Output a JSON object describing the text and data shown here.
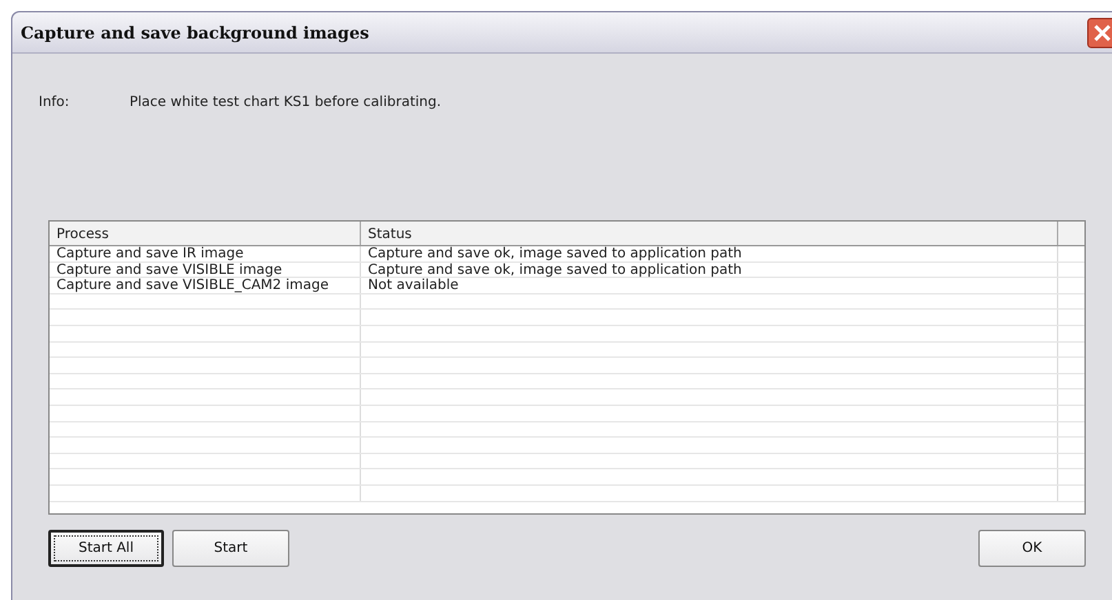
{
  "window": {
    "title": "Capture and save background images"
  },
  "info": {
    "label": "Info:",
    "text": "Place white test chart KS1 before calibrating."
  },
  "table": {
    "columns": [
      "Process",
      "Status"
    ],
    "rows": [
      {
        "process": "Capture and save IR image",
        "status": "Capture and save ok, image saved to application path"
      },
      {
        "process": "Capture and save VISIBLE image",
        "status": "Capture and save ok, image saved to application path"
      },
      {
        "process": "Capture and save VISIBLE_CAM2 image",
        "status": "Not available"
      }
    ]
  },
  "buttons": [
    {
      "label": "Start All",
      "focused": true
    },
    {
      "label": "Start",
      "focused": false
    },
    {
      "label": "OK",
      "focused": false
    }
  ]
}
